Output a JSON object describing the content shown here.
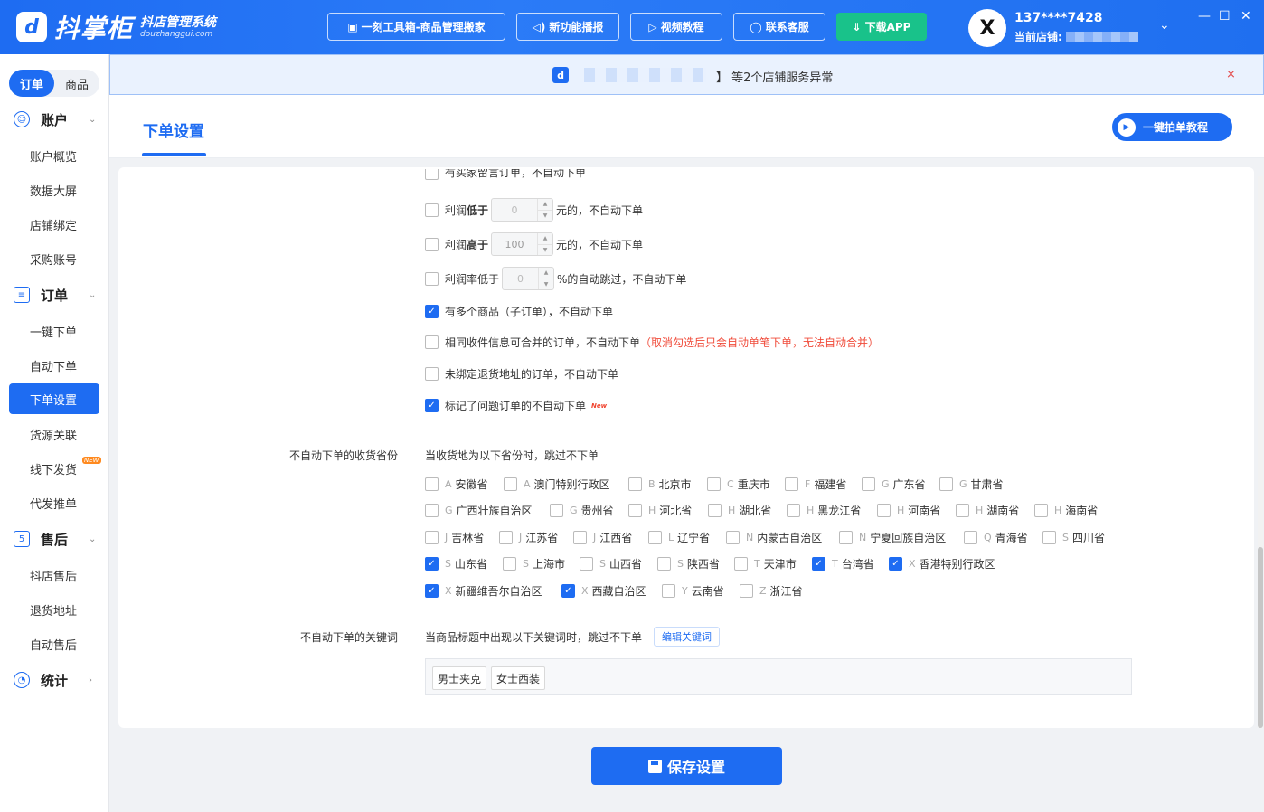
{
  "header": {
    "logo_mark": "d",
    "logo_text": "抖掌柜",
    "logo_sub": "抖店管理系统",
    "logo_domain": "douzhanggui.com",
    "buttons": [
      {
        "label": "一刻工具箱-商品管理搬家",
        "icon": "toolbox-icon"
      },
      {
        "label": "新功能播报",
        "icon": "speaker-icon"
      },
      {
        "label": "视频教程",
        "icon": "video-icon"
      },
      {
        "label": "联系客服",
        "icon": "headset-icon"
      },
      {
        "label": "下载APP",
        "icon": "download-icon"
      }
    ],
    "avatar_letter": "X",
    "phone": "137****7428",
    "shop_label": "当前店铺:",
    "window_controls": [
      "—",
      "☐",
      "✕"
    ]
  },
  "sidebar": {
    "segment": {
      "orders": "订单",
      "products": "商品"
    },
    "groups": [
      {
        "label": "账户",
        "icon": "account-icon",
        "items": [
          "账户概览",
          "数据大屏",
          "店铺绑定",
          "采购账号"
        ]
      },
      {
        "label": "订单",
        "icon": "order-icon",
        "items": [
          "一键下单",
          "自动下单",
          "下单设置",
          "货源关联",
          "线下发货",
          "代发推单"
        ]
      },
      {
        "label": "售后",
        "icon": "aftersale-icon",
        "items": [
          "抖店售后",
          "退货地址",
          "自动售后"
        ]
      },
      {
        "label": "统计",
        "icon": "stats-icon",
        "items": []
      }
    ],
    "new_badge": "NEW"
  },
  "banner": {
    "text": "】 等2个店铺服务异常",
    "close": "×"
  },
  "page": {
    "title": "下单设置",
    "tutorial_button": "一键拍单教程"
  },
  "settings": {
    "cut_top": "有买家留言订单，不自动下单",
    "profit_low": {
      "pre": "利润",
      "bold": "低于",
      "value": "0",
      "post": "元的，不自动下单"
    },
    "profit_high": {
      "pre": "利润",
      "bold": "高于",
      "value": "100",
      "post": "元的，不自动下单"
    },
    "profit_rate": {
      "pre": "利润率低于",
      "value": "0",
      "post": "%的自动跳过，不自动下单"
    },
    "multi_items": "有多个商品（子订单），不自动下单",
    "merge": "相同收件信息可合并的订单，不自动下单",
    "merge_warn": "（取消勾选后只会自动单笔下单，无法自动合并）",
    "no_return_addr": "未绑定退货地址的订单，不自动下单",
    "problem_orders": "标记了问题订单的不自动下单",
    "new_tag": "New"
  },
  "provinces": {
    "label": "不自动下单的收货省份",
    "desc": "当收货地为以下省份时，跳过不下单",
    "items": [
      {
        "i": "A",
        "n": "安徽省",
        "c": false
      },
      {
        "i": "A",
        "n": "澳门特别行政区",
        "c": false
      },
      {
        "i": "B",
        "n": "北京市",
        "c": false
      },
      {
        "i": "C",
        "n": "重庆市",
        "c": false
      },
      {
        "i": "F",
        "n": "福建省",
        "c": false
      },
      {
        "i": "G",
        "n": "广东省",
        "c": false
      },
      {
        "i": "G",
        "n": "甘肃省",
        "c": false
      },
      {
        "i": "G",
        "n": "广西壮族自治区",
        "c": false
      },
      {
        "i": "G",
        "n": "贵州省",
        "c": false
      },
      {
        "i": "H",
        "n": "河北省",
        "c": false
      },
      {
        "i": "H",
        "n": "湖北省",
        "c": false
      },
      {
        "i": "H",
        "n": "黑龙江省",
        "c": false
      },
      {
        "i": "H",
        "n": "河南省",
        "c": false
      },
      {
        "i": "H",
        "n": "湖南省",
        "c": false
      },
      {
        "i": "H",
        "n": "海南省",
        "c": false
      },
      {
        "i": "J",
        "n": "吉林省",
        "c": false
      },
      {
        "i": "J",
        "n": "江苏省",
        "c": false
      },
      {
        "i": "J",
        "n": "江西省",
        "c": false
      },
      {
        "i": "L",
        "n": "辽宁省",
        "c": false
      },
      {
        "i": "N",
        "n": "内蒙古自治区",
        "c": false
      },
      {
        "i": "N",
        "n": "宁夏回族自治区",
        "c": false
      },
      {
        "i": "Q",
        "n": "青海省",
        "c": false
      },
      {
        "i": "S",
        "n": "四川省",
        "c": false
      },
      {
        "i": "S",
        "n": "山东省",
        "c": true
      },
      {
        "i": "S",
        "n": "上海市",
        "c": false
      },
      {
        "i": "S",
        "n": "山西省",
        "c": false
      },
      {
        "i": "S",
        "n": "陕西省",
        "c": false
      },
      {
        "i": "T",
        "n": "天津市",
        "c": false
      },
      {
        "i": "T",
        "n": "台湾省",
        "c": true
      },
      {
        "i": "X",
        "n": "香港特别行政区",
        "c": true
      },
      {
        "i": "X",
        "n": "新疆维吾尔自治区",
        "c": true
      },
      {
        "i": "X",
        "n": "西藏自治区",
        "c": true
      },
      {
        "i": "Y",
        "n": "云南省",
        "c": false
      },
      {
        "i": "Z",
        "n": "浙江省",
        "c": false
      }
    ]
  },
  "keywords": {
    "label": "不自动下单的关键词",
    "desc": "当商品标题中出现以下关键词时，跳过不下单",
    "edit": "编辑关键词",
    "tags": [
      "男士夹克",
      "女士西装"
    ]
  },
  "save_button": "保存设置",
  "colors": {
    "primary": "#1e6cf2",
    "success": "#19c28a",
    "danger": "#f04b3a"
  }
}
